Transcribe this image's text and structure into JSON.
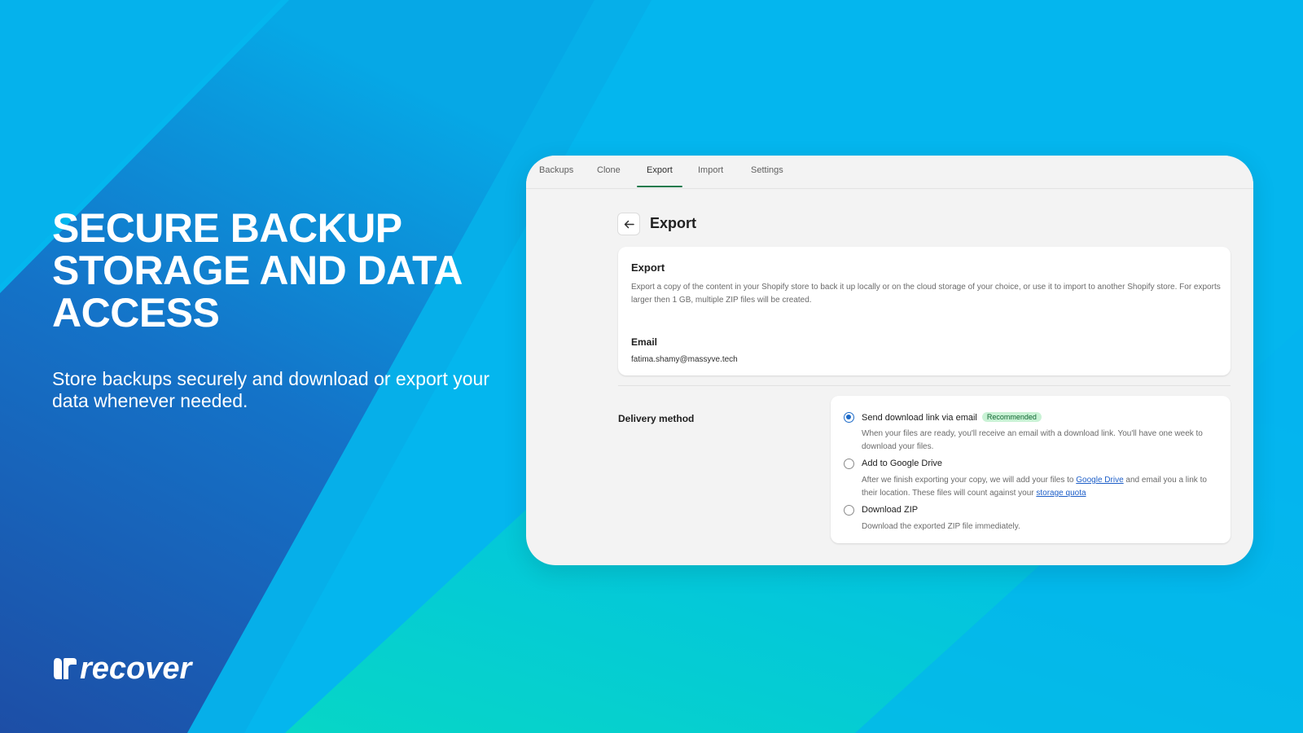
{
  "hero": {
    "title_lines": [
      "SECURE BACKUP",
      "STORAGE AND DATA",
      "ACCESS"
    ],
    "subtitle": "Store backups securely and download or export your data whenever needed."
  },
  "logo": {
    "text": "recover",
    "mark_icon": "recover-mark-icon"
  },
  "app": {
    "tabs": [
      {
        "label": "Backups"
      },
      {
        "label": "Clone"
      },
      {
        "label": "Export",
        "active": true
      },
      {
        "label": "Import"
      },
      {
        "label": "Settings"
      }
    ],
    "page_title": "Export",
    "back_icon": "arrow-left-icon",
    "export_card": {
      "title": "Export",
      "description": "Export a copy of the content in your Shopify store to back it up locally or on the cloud storage of your choice, or use it to import to another Shopify store. For exports larger then 1 GB, multiple ZIP files will be created.",
      "email_label": "Email",
      "email_value": "fatima.shamy@massyve.tech"
    },
    "delivery": {
      "label": "Delivery method",
      "options": [
        {
          "label": "Send download link via email",
          "badge": "Recommended",
          "checked": true,
          "description": "When your files are ready, you'll receive an email with a download link. You'll have one week to download your files."
        },
        {
          "label": "Add to Google Drive",
          "checked": false,
          "desc_part1": "After we finish exporting your copy, we will add your files to ",
          "desc_link1": "Google Drive",
          "desc_part2": " and email you a link to their location. These files will count against your ",
          "desc_link2": "storage quota"
        },
        {
          "label": "Download ZIP",
          "checked": false,
          "description": "Download the exported ZIP file immediately."
        }
      ]
    }
  },
  "colors": {
    "accent_blue": "#1c6ac8",
    "tab_active_underline": "#1a7a4c",
    "badge_bg": "#c9f2d5",
    "background_cyan": "#04b6ee",
    "background_dark_blue": "#1e4fa8"
  }
}
